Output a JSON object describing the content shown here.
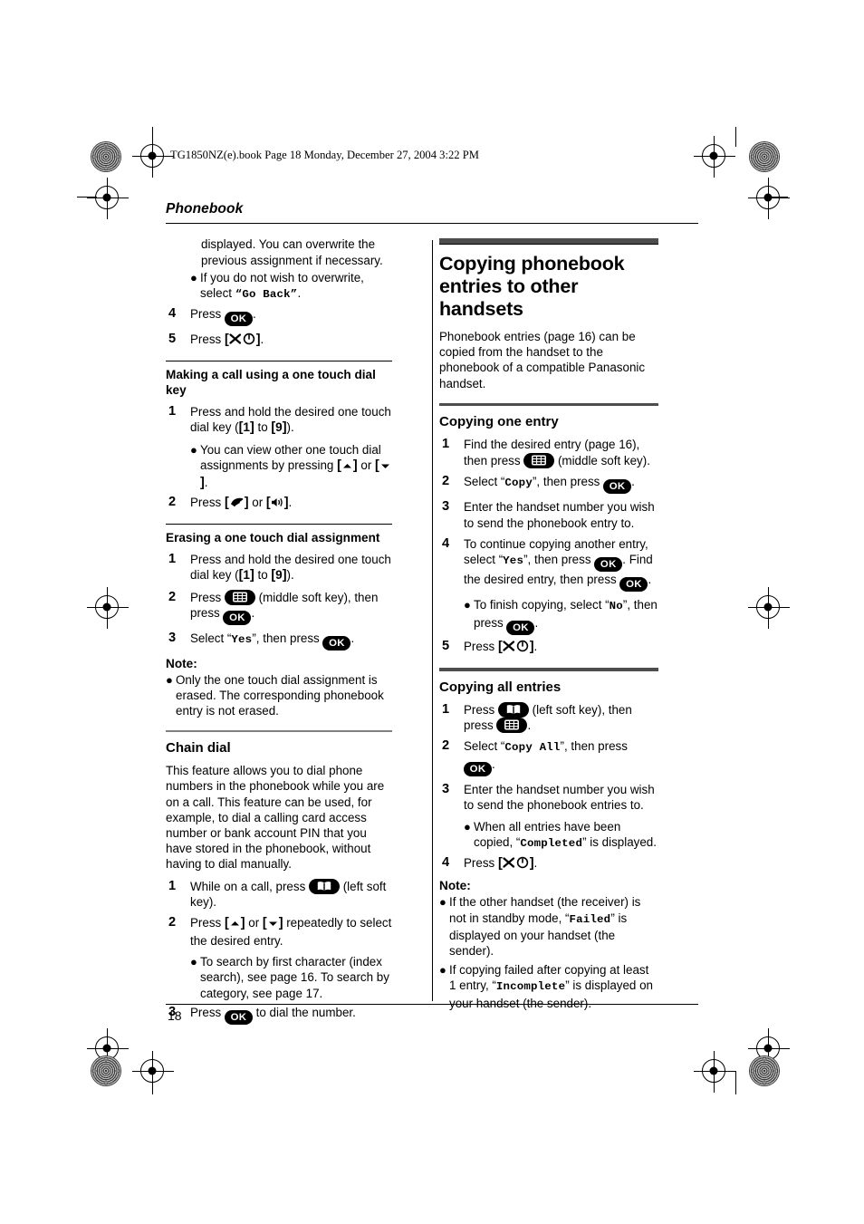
{
  "file_header": "TG1850NZ(e).book  Page 18  Monday, December 27, 2004  3:22 PM",
  "running_head": "Phonebook",
  "page_number": "18",
  "icons": {
    "ok_label": "OK",
    "middle_soft_key": "grid-icon",
    "left_soft_key": "phonebook-book-icon",
    "talk_key": "handset-icon",
    "speakerphone_key": "speakerphone-icon",
    "power_off_key": "power-off-icon",
    "up_key": "up-arrow-icon",
    "down_key": "down-arrow-icon"
  },
  "left_column": {
    "continuation": {
      "text": "displayed. You can overwrite the previous assignment if necessary.",
      "bullet": {
        "before": "If you do not wish to overwrite, select ",
        "mono": "Go Back",
        "after": "."
      },
      "steps": [
        {
          "num": "4",
          "before": "Press ",
          "after": "."
        },
        {
          "num": "5",
          "before": "Press ",
          "after": "."
        }
      ]
    },
    "making_call": {
      "heading": "Making a call using a one touch dial key",
      "step1": {
        "num": "1",
        "text_a": "Press and hold the desired one touch dial key (",
        "key_from": "1",
        "to_word": " to ",
        "key_to": "9",
        "text_b": ")."
      },
      "step1_bullet": {
        "text_a": "You can view other one touch dial assignments by pressing ",
        "or_word": " or ",
        "text_b": "."
      },
      "step2": {
        "num": "2",
        "text_a": "Press ",
        "or_word": " or ",
        "text_b": "."
      }
    },
    "erasing": {
      "heading": "Erasing a one touch dial assignment",
      "step1": {
        "num": "1",
        "text_a": "Press and hold the desired one touch dial key (",
        "key_from": "1",
        "to_word": " to ",
        "key_to": "9",
        "text_b": ")."
      },
      "step2": {
        "num": "2",
        "text_a": "Press ",
        "text_b": " (middle soft key), then press ",
        "text_c": "."
      },
      "step3": {
        "num": "3",
        "text_a": "Select “",
        "mono": "Yes",
        "text_b": "”, then press ",
        "text_c": "."
      },
      "note_label": "Note:",
      "note_bullet": "Only the one touch dial assignment is erased. The corresponding phonebook entry is not erased."
    },
    "chain_dial": {
      "heading": "Chain dial",
      "intro": "This feature allows you to dial phone numbers in the phonebook while you are on a call. This feature can be used, for example, to dial a calling card access number or bank account PIN that you have stored in the phonebook, without having to dial manually.",
      "step1": {
        "num": "1",
        "text_a": "While on a call, press ",
        "text_b": " (left soft key)."
      },
      "step2": {
        "num": "2",
        "text_a": "Press ",
        "or_word": " or ",
        "text_b": " repeatedly to select the desired entry."
      },
      "step2_bullet": "To search by first character (index search), see page 16. To search by category, see page 17.",
      "step3": {
        "num": "3",
        "text_a": "Press ",
        "text_b": " to dial the number."
      }
    }
  },
  "right_column": {
    "chapter_title": "Copying phonebook entries to other handsets",
    "intro": "Phonebook entries (page 16) can be copied from the handset to the phonebook of a compatible Panasonic handset.",
    "copying_one": {
      "heading": "Copying one entry",
      "step1": {
        "num": "1",
        "text_a": "Find the desired entry (page 16), then press ",
        "text_b": " (middle soft key)."
      },
      "step2": {
        "num": "2",
        "text_a": "Select “",
        "mono": "Copy",
        "text_b": "”, then press ",
        "text_c": "."
      },
      "step3": {
        "num": "3",
        "text": "Enter the handset number you wish to send the phonebook entry to."
      },
      "step4": {
        "num": "4",
        "text_a": "To continue copying another entry, select “",
        "mono": "Yes",
        "text_b": "”, then press ",
        "text_c": ". Find the desired entry, then press ",
        "text_d": "."
      },
      "step4_bullet": {
        "text_a": "To finish copying, select “",
        "mono": "No",
        "text_b": "”, then press ",
        "text_c": "."
      },
      "step5": {
        "num": "5",
        "text_a": "Press ",
        "text_b": "."
      }
    },
    "copying_all": {
      "heading": "Copying all entries",
      "step1": {
        "num": "1",
        "text_a": "Press ",
        "text_b": " (left soft key), then press ",
        "text_c": "."
      },
      "step2": {
        "num": "2",
        "text_a": "Select “",
        "mono": "Copy All",
        "text_b": "”, then press ",
        "text_c": "."
      },
      "step3": {
        "num": "3",
        "text": "Enter the handset number you wish to send the phonebook entries to."
      },
      "step3_bullet": {
        "text_a": "When all entries have been copied, “",
        "mono": "Completed",
        "text_b": "” is displayed."
      },
      "step4": {
        "num": "4",
        "text_a": "Press ",
        "text_b": "."
      },
      "note_label": "Note:",
      "note_bullets": [
        {
          "text_a": "If the other handset (the receiver) is not in standby mode, “",
          "mono": "Failed",
          "text_b": "” is displayed on your handset (the sender)."
        },
        {
          "text_a": "If copying failed after copying at least 1 entry, “",
          "mono": "Incomplete",
          "text_b": "” is displayed on your handset (the sender)."
        }
      ]
    }
  }
}
